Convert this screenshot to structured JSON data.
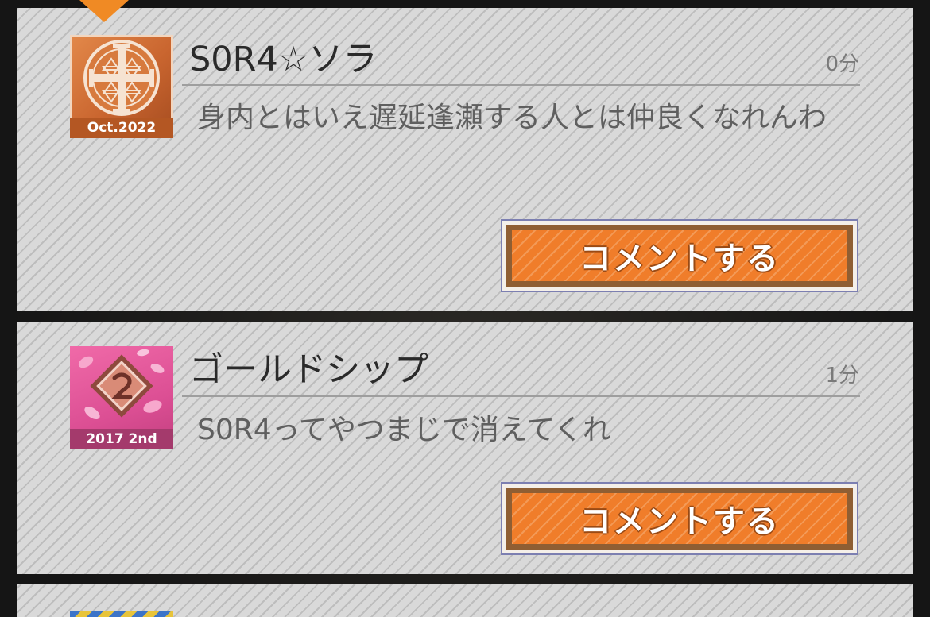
{
  "posts": [
    {
      "badge_caption": "Oct.2022",
      "author": "S0R4☆ソラ",
      "time": "0分",
      "message": "身内とはいえ遅延逢瀬する人とは仲良くなれんわ",
      "button_label": "コメントする",
      "badge_color": "#c9652f"
    },
    {
      "badge_caption": "2017 2nd",
      "author": "ゴールドシップ",
      "time": "1分",
      "message": "S0R4ってやつまじで消えてくれ",
      "button_label": "コメントする",
      "badge_color": "#dc4f94"
    }
  ],
  "colors": {
    "accent": "#f07d2a",
    "button_border": "#8f5e33",
    "card_bg": "#d4d4d4"
  }
}
